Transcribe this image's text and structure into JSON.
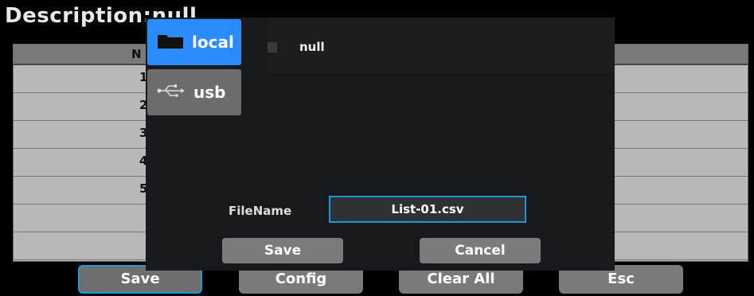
{
  "description": {
    "label": "Description:",
    "value": "null"
  },
  "table": {
    "header": "N",
    "rows": [
      "1",
      "2",
      "3",
      "4",
      "5",
      "",
      ""
    ]
  },
  "bottom_buttons": [
    "Save",
    "Config",
    "Clear All",
    "Esc"
  ],
  "dialog": {
    "locations": [
      {
        "label": "local",
        "icon": "folder-icon"
      },
      {
        "label": "usb",
        "icon": "usb-icon"
      }
    ],
    "file_entry": "null",
    "filename_label": "FileName",
    "filename_value": "List-01.csv",
    "buttons": [
      "Save",
      "Cancel"
    ]
  },
  "colors": {
    "accent": "#2a8cff",
    "focus_border": "#1e9ad0"
  }
}
